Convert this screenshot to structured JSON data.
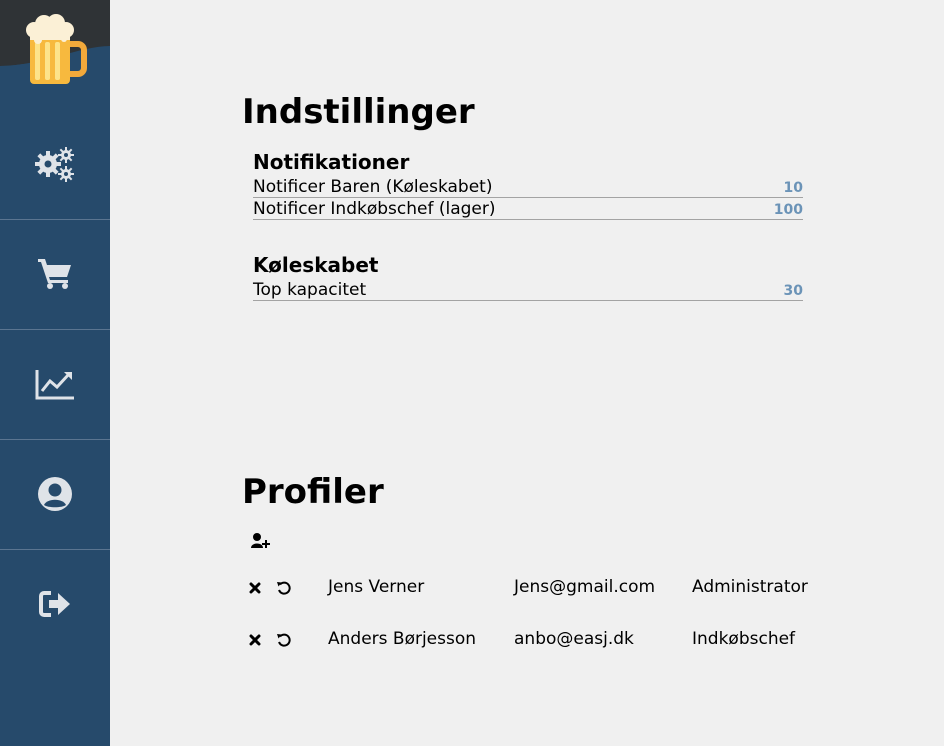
{
  "sidebar": {
    "logo": "beer-mug-logo",
    "items": [
      {
        "name": "settings",
        "icon": "gears-icon"
      },
      {
        "name": "cart",
        "icon": "shopping-cart-icon"
      },
      {
        "name": "stats",
        "icon": "line-chart-icon"
      },
      {
        "name": "profile",
        "icon": "user-circle-icon"
      },
      {
        "name": "logout",
        "icon": "sign-out-icon"
      }
    ]
  },
  "settings": {
    "title": "Indstillinger",
    "notifications": {
      "heading": "Notifikationer",
      "rows": [
        {
          "label": "Notificer Baren (Køleskabet)",
          "value": "10"
        },
        {
          "label": "Notificer Indkøbschef (lager)",
          "value": "100"
        }
      ]
    },
    "fridge": {
      "heading": "Køleskabet",
      "rows": [
        {
          "label": "Top kapacitet",
          "value": "30"
        }
      ]
    }
  },
  "profiles": {
    "title": "Profiler",
    "add_icon": "user-plus-icon",
    "rows": [
      {
        "name": "Jens Verner",
        "email": "Jens@gmail.com",
        "role": "Administrator"
      },
      {
        "name": "Anders Børjesson",
        "email": "anbo@easj.dk",
        "role": "Indkøbschef"
      }
    ]
  },
  "colors": {
    "sidebar": "#264a6b",
    "logo_bg": "#2f3336",
    "background": "#f0f0f0",
    "value_accent": "#6b93b7",
    "icon": "#dfe3e8"
  }
}
